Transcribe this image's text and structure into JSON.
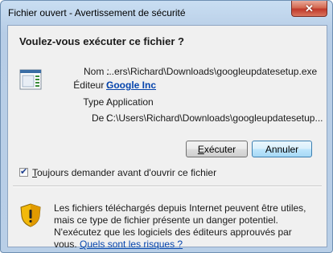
{
  "window": {
    "title": "Fichier ouvert - Avertissement de sécurité",
    "close_label": "✕"
  },
  "dialog": {
    "heading": "Voulez-vous exécuter ce fichier ?",
    "icon": "executable-file-icon",
    "fields": [
      {
        "label": "Nom :",
        "value": "...ers\\Richard\\Downloads\\googleupdatesetup.exe"
      },
      {
        "label": "Éditeur :",
        "value": "Google Inc"
      },
      {
        "label": "Type :",
        "value": "Application"
      },
      {
        "label": "De :",
        "value": "C:\\Users\\Richard\\Downloads\\googleupdatesetup..."
      }
    ],
    "run_button": {
      "prefix": "",
      "accel": "E",
      "rest": "xécuter"
    },
    "cancel_button": "Annuler",
    "checkbox": {
      "checked": true,
      "prefix": "",
      "accel": "T",
      "rest": "oujours demander avant d'ouvrir ce fichier"
    },
    "warning": {
      "icon": "security-shield-icon",
      "text": "Les fichiers téléchargés depuis Internet peuvent être utiles, mais ce type de fichier présente un danger potentiel. N'exécutez que les logiciels des éditeurs approuvés par vous.",
      "link": "Quels sont les risques ?"
    }
  },
  "colors": {
    "link": "#0645ad",
    "title_bar": "#b9cfe7",
    "dialog_bg": "#f0f0f0"
  }
}
